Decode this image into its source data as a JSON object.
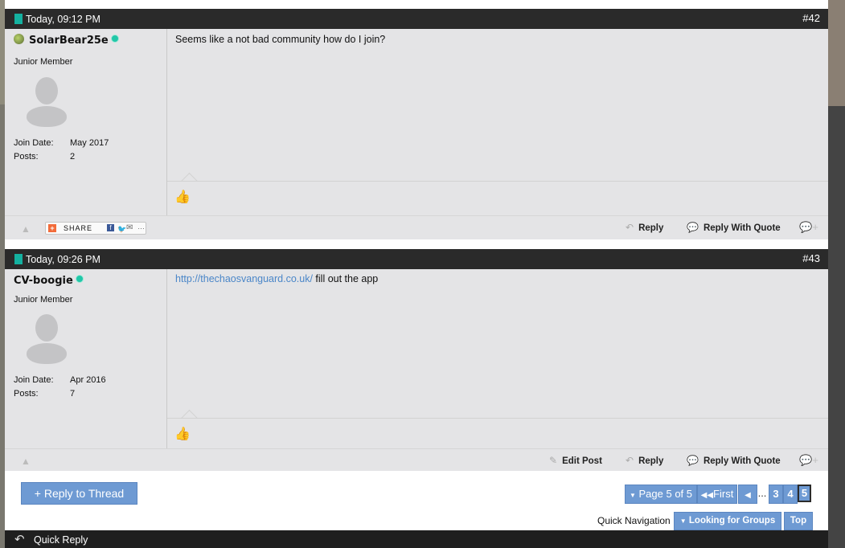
{
  "posts": [
    {
      "date": "Today, 09:12 PM",
      "number": "#42",
      "username": "SolarBear25e",
      "rank": "Junior Member",
      "join_label": "Join Date:",
      "join_date": "May 2017",
      "posts_label": "Posts:",
      "posts_count": "2",
      "message": "Seems like a not bad community how do I join?",
      "share_label": "SHARE",
      "reply_label": "Reply",
      "reply_quote_label": "Reply With Quote"
    },
    {
      "date": "Today, 09:26 PM",
      "number": "#43",
      "username": "CV-boogie",
      "rank": "Junior Member",
      "join_label": "Join Date:",
      "join_date": "Apr 2016",
      "posts_label": "Posts:",
      "posts_count": "7",
      "message_link": "http://thechaosvanguard.co.uk/",
      "message_text": " fill out the app",
      "edit_label": "Edit Post",
      "reply_label": "Reply",
      "reply_quote_label": "Reply With Quote"
    }
  ],
  "reply_to_thread": "+ Reply to Thread",
  "pagination": {
    "page_label": "Page 5 of 5",
    "first_label": "First",
    "ellipsis": "...",
    "pages": [
      "3",
      "4",
      "5"
    ],
    "current": "5"
  },
  "quick_navigation": {
    "label": "Quick Navigation",
    "forum": "Looking for Groups",
    "top": "Top"
  },
  "quick_reply": "Quick Reply",
  "colors": {
    "accent": "#6e9ad3",
    "header": "#2a2a2a",
    "post_bg": "#e4e4e6",
    "online": "#21c7a8",
    "link": "#4a86c8"
  }
}
